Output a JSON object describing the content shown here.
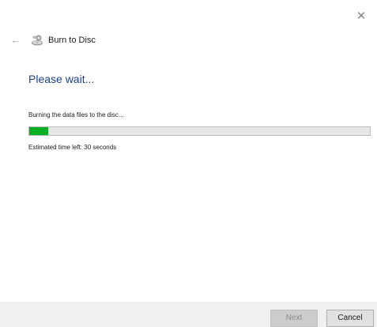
{
  "window": {
    "close_glyph": "✕",
    "back_glyph": "←",
    "title": "Burn to Disc",
    "icon": "disc-burn-icon"
  },
  "main": {
    "heading": "Please wait...",
    "status": "Burning the data files to the disc...",
    "progress_fraction": 0.055,
    "progress_color": "#06b025",
    "time_left": "Estimated time left: 30 seconds"
  },
  "footer": {
    "next_label": "Next",
    "cancel_label": "Cancel"
  }
}
